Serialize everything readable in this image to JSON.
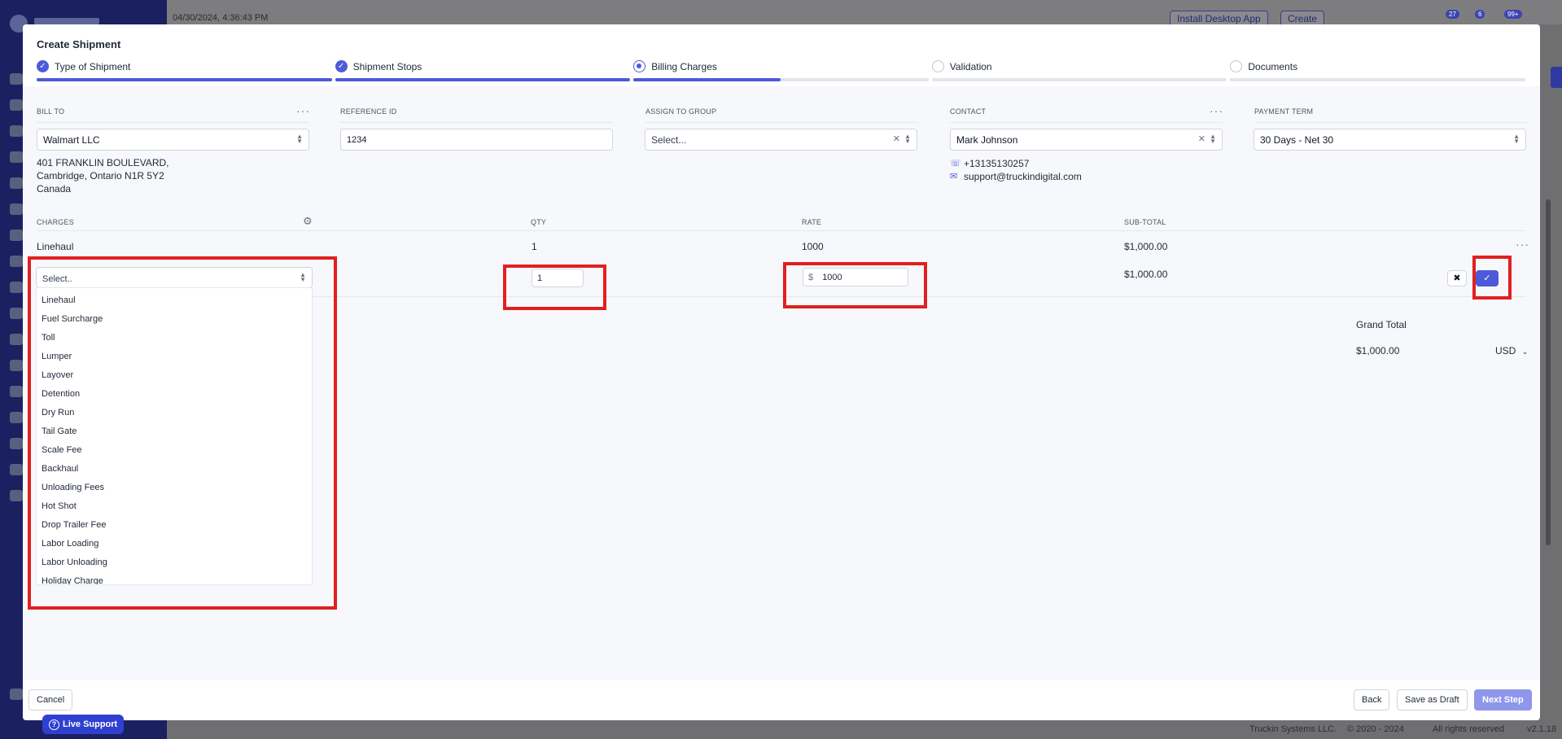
{
  "background": {
    "timestamp": "04/30/2024, 4:36:43 PM",
    "install_label": "Install Desktop App",
    "create_label": "Create",
    "badges": [
      "27",
      "6",
      "99+"
    ],
    "footer_company": "Truckin Systems LLC.",
    "footer_copyright": "© 2020 - 2024",
    "footer_rights": "All rights reserved",
    "footer_version": "v2.1.18"
  },
  "modal": {
    "title": "Create Shipment",
    "steps": [
      {
        "label": "Type of Shipment",
        "state": "done",
        "progress": 1.0
      },
      {
        "label": "Shipment Stops",
        "state": "done",
        "progress": 1.0
      },
      {
        "label": "Billing Charges",
        "state": "current",
        "progress": 0.5
      },
      {
        "label": "Validation",
        "state": "todo",
        "progress": 0
      },
      {
        "label": "Documents",
        "state": "todo",
        "progress": 0
      }
    ]
  },
  "billing": {
    "bill_to": {
      "label": "BILL TO",
      "value": "Walmart LLC",
      "address_line1": "401 FRANKLIN BOULEVARD,",
      "address_line2": "Cambridge, Ontario N1R 5Y2",
      "address_line3": "Canada"
    },
    "reference_id": {
      "label": "REFERENCE ID",
      "value": "1234"
    },
    "assign_to_group": {
      "label": "ASSIGN TO GROUP",
      "placeholder": "Select..."
    },
    "contact": {
      "label": "CONTACT",
      "value": "Mark Johnson",
      "phone": "+13135130257",
      "email": "support@truckindigital.com"
    },
    "payment_term": {
      "label": "PAYMENT TERM",
      "value": "30 Days - Net 30"
    }
  },
  "charges": {
    "headers": {
      "charges": "CHARGES",
      "qty": "QTY",
      "rate": "RATE",
      "subtotal": "SUB-TOTAL"
    },
    "existing_row": {
      "charge": "Linehaul",
      "qty": "1",
      "rate": "1000",
      "subtotal": "$1,000.00"
    },
    "edit_row": {
      "select_placeholder": "Select..",
      "qty": "1",
      "rate_prefix": "$",
      "rate": "1000",
      "subtotal": "$1,000.00",
      "cancel_glyph": "✖",
      "confirm_glyph": "✓"
    },
    "options": [
      "Linehaul",
      "Fuel Surcharge",
      "Toll",
      "Lumper",
      "Layover",
      "Detention",
      "Dry Run",
      "Tail Gate",
      "Scale Fee",
      "Backhaul",
      "Unloading Fees",
      "Hot Shot",
      "Drop Trailer Fee",
      "Labor Loading",
      "Labor Unloading",
      "Holiday Charge"
    ],
    "grand_total_label": "Grand Total",
    "grand_total_value": "$1,000.00",
    "currency": "USD"
  },
  "footer": {
    "cancel": "Cancel",
    "back": "Back",
    "save_draft": "Save as Draft",
    "next": "Next Step"
  },
  "live_support": "Live Support"
}
